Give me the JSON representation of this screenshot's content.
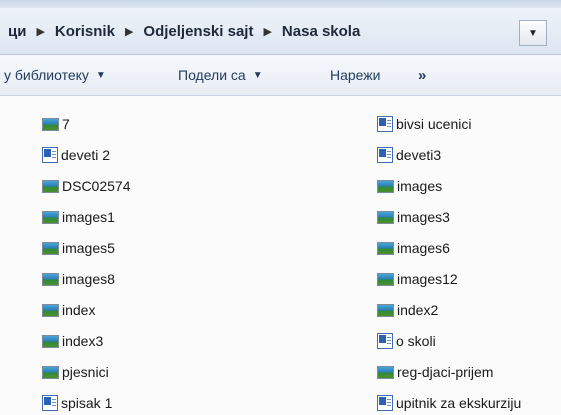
{
  "breadcrumb": {
    "items": [
      "ци",
      "Korisnik",
      "Odjeljenski sajt",
      "Nasa skola"
    ],
    "separator": "▶"
  },
  "toolbar": {
    "library_label": "у библиотеку",
    "share_label": "Подели са",
    "burn_label": "Нарежи",
    "more_label": "»"
  },
  "icons": {
    "dropdown": "chevron-down-icon",
    "image": "image-file-icon",
    "word": "word-document-icon"
  },
  "colors": {
    "toolbar_text": "#1f3a5c",
    "file_text": "#1a1a1a"
  },
  "files": {
    "left": [
      {
        "name": "7",
        "type": "image"
      },
      {
        "name": "deveti 2",
        "type": "word"
      },
      {
        "name": "DSC02574",
        "type": "image"
      },
      {
        "name": "images1",
        "type": "image"
      },
      {
        "name": "images5",
        "type": "image"
      },
      {
        "name": "images8",
        "type": "image"
      },
      {
        "name": "index",
        "type": "image"
      },
      {
        "name": "index3",
        "type": "image"
      },
      {
        "name": "pjesnici",
        "type": "image"
      },
      {
        "name": "spisak 1",
        "type": "word"
      }
    ],
    "right": [
      {
        "name": "bivsi ucenici",
        "type": "word"
      },
      {
        "name": "deveti3",
        "type": "word"
      },
      {
        "name": "images",
        "type": "image"
      },
      {
        "name": "images3",
        "type": "image"
      },
      {
        "name": "images6",
        "type": "image"
      },
      {
        "name": "images12",
        "type": "image"
      },
      {
        "name": "index2",
        "type": "image"
      },
      {
        "name": "o skoli",
        "type": "word"
      },
      {
        "name": "reg-djaci-prijem",
        "type": "image"
      },
      {
        "name": "upitnik za ekskurziju",
        "type": "word"
      }
    ]
  }
}
